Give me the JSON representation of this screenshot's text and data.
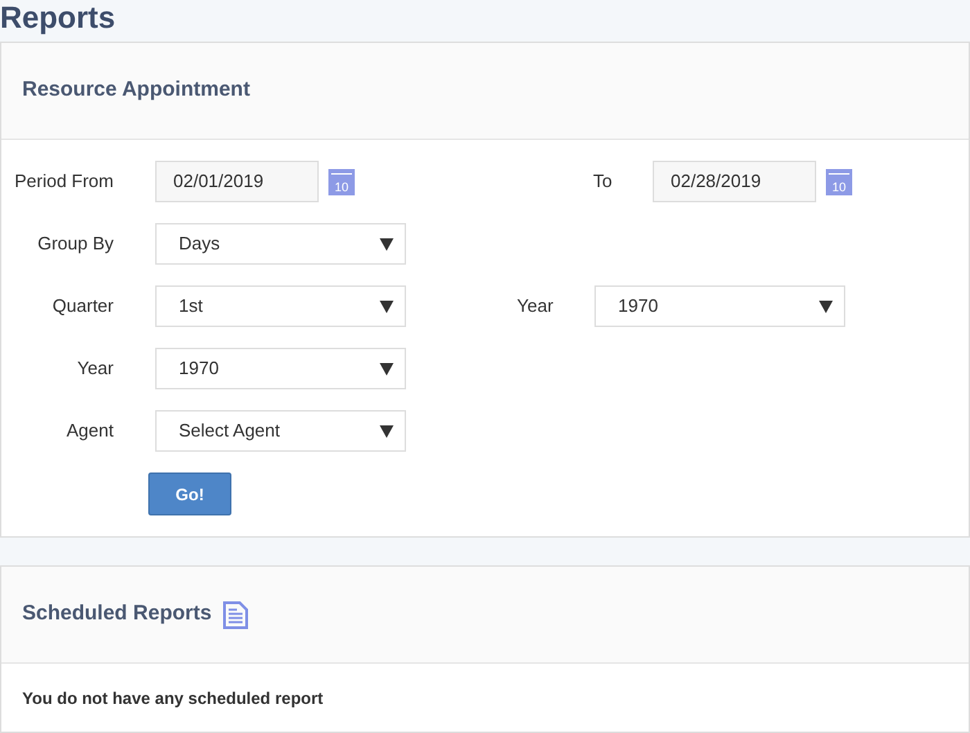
{
  "page_title": "Reports",
  "form_panel": {
    "title": "Resource Appointment",
    "rows": [
      {
        "fields": [
          {
            "kind": "date",
            "label": "Period From",
            "value": "02/01/2019",
            "calendar_badge": "10"
          },
          {
            "kind": "date",
            "label": "To",
            "value": "02/28/2019",
            "calendar_badge": "10"
          }
        ]
      },
      {
        "fields": [
          {
            "kind": "select",
            "label": "Group By",
            "value": "Days"
          }
        ]
      },
      {
        "fields": [
          {
            "kind": "select",
            "label": "Quarter",
            "value": "1st"
          },
          {
            "kind": "select",
            "label": "Year",
            "value": "1970"
          }
        ]
      },
      {
        "fields": [
          {
            "kind": "select",
            "label": "Year",
            "value": "1970"
          }
        ]
      },
      {
        "fields": [
          {
            "kind": "select",
            "label": "Agent",
            "value": "Select Agent"
          }
        ]
      }
    ],
    "submit": "Go!"
  },
  "scheduled_panel": {
    "title": "Scheduled Reports",
    "message": "You do not have any scheduled report"
  }
}
